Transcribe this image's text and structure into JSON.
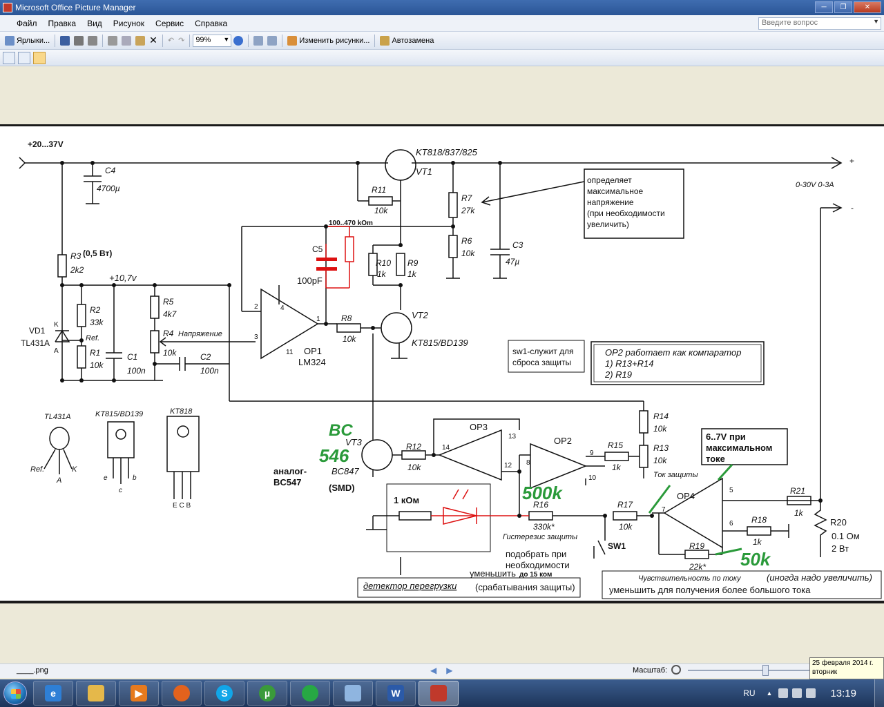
{
  "window": {
    "title": "Microsoft Office Picture Manager"
  },
  "menu": {
    "items": [
      "Файл",
      "Правка",
      "Вид",
      "Рисунок",
      "Сервис",
      "Справка"
    ],
    "help_placeholder": "Введите вопрос"
  },
  "toolbar": {
    "shortcuts": "Ярлыки...",
    "zoom": "99%",
    "edit_pictures": "Изменить рисунки...",
    "autocorrect": "Автозамена"
  },
  "status": {
    "filename": "____.png",
    "zoom_label": "Масштаб:",
    "date_line1": "25 февраля 2014 г.",
    "date_line2": "вторник"
  },
  "taskbar": {
    "lang": "RU",
    "clock": "13:19"
  },
  "schematic": {
    "supply": "+20...37V",
    "vt1_type": "KT818/837/825",
    "vt1": "VT1",
    "c4": "C4",
    "c4_val": "4700µ",
    "r11": "R11",
    "r11_val": "10k",
    "r7": "R7",
    "r7_val": "27k",
    "r6": "R6",
    "r6_val": "10k",
    "c3": "C3",
    "c3_val": "47µ",
    "out_plus": "+",
    "out_minus": "-",
    "out_range": "0-30V 0-3A",
    "note_r7": [
      "определяет",
      "максимальное",
      "напряжение",
      "(при необходимости",
      "увеличить)"
    ],
    "r_range": "100..470 kOm",
    "c5": "C5",
    "c5_val": "100pF",
    "r10": "R10",
    "r10_val": "1k",
    "r9": "R9",
    "r9_val": "1k",
    "r3": "R3",
    "r3_power": "(0,5 Вт)",
    "r3_val": "2k2",
    "v107": "+10,7v",
    "r2": "R2",
    "r2_val": "33k",
    "ref": "Ref.",
    "r1": "R1",
    "r1_val": "10k",
    "vd1": "VD1",
    "tl431": "TL431A",
    "k": "K",
    "a": "A",
    "c1": "C1",
    "c1_val": "100n",
    "r5": "R5",
    "r5_val": "4k7",
    "r4": "R4",
    "r4_val": "10k",
    "voltage": "Напряжение",
    "c2": "C2",
    "c2_val": "100n",
    "op1": "OP1",
    "lm324": "LM324",
    "pin2": "2",
    "pin3": "3",
    "pin4": "4",
    "pin11": "11",
    "pin1": "1",
    "r8": "R8",
    "r8_val": "10k",
    "vt2": "VT2",
    "vt2_type": "KT815/BD139",
    "sw1_note": [
      "sw1-служит для",
      "сброса защиты"
    ],
    "op2_note": [
      "OP2 работает как компаратор",
      "1) R13+R14",
      "2) R19"
    ],
    "pkg_tl431": "TL431A",
    "pkg_ref": "Ref.",
    "pkg_a": "A",
    "pkg_k": "K",
    "pkg_kt815": "KT815/BD139",
    "pkg_ecb": [
      "e",
      "c",
      "b"
    ],
    "pkg_kt818": "KT818",
    "pkg_ecb2": "E C B",
    "green_bc": "BC",
    "green_546": "546",
    "green_500k": "500k",
    "green_50k": "50k",
    "vt3": "VT3",
    "vt3_type": "BC847",
    "smd": "(SMD)",
    "analog": "аналог-",
    "bc547": "BC547",
    "r12": "R12",
    "r12_val": "10k",
    "op3": "OP3",
    "pin13": "13",
    "pin14": "14",
    "pin12": "12",
    "op2": "OP2",
    "pin8": "8",
    "pin9": "9",
    "pin10": "10",
    "r14": "R14",
    "r14_val": "10k",
    "r15": "R15",
    "r15_val": "1k",
    "r13": "R13",
    "r13_val": "10k",
    "prot_current": "Ток защиты",
    "note_67": [
      "6..7V при",
      "максимальном",
      "токе"
    ],
    "r16": "R16",
    "r16_val": "330k*",
    "hysteresis": "Гистерезис защиты",
    "r17": "R17",
    "r17_val": "10k",
    "op4": "OP4",
    "pin7": "7",
    "pin5": "5",
    "pin6": "6",
    "r21": "R21",
    "r21_val": "1k",
    "r20": "R20",
    "r20_val": "0.1 Ом",
    "r20_pow": "2 Вт",
    "r18": "R18",
    "r18_val": "1k",
    "r19": "R19",
    "r19_val": "22k*",
    "sw1": "SW1",
    "one_kom": "1 кОм",
    "pick": [
      "подобрать при",
      "необходимости"
    ],
    "reduce": "уменьшить",
    "upto15": "до 15 ком",
    "overload": "детектор перегрузки",
    "trigger": "(срабатывания защиты)",
    "sens": "Чувствительность по току",
    "sens_note": "(иногда надо увеличить)",
    "reduce_more": "уменьшить для получения более большого тока"
  }
}
